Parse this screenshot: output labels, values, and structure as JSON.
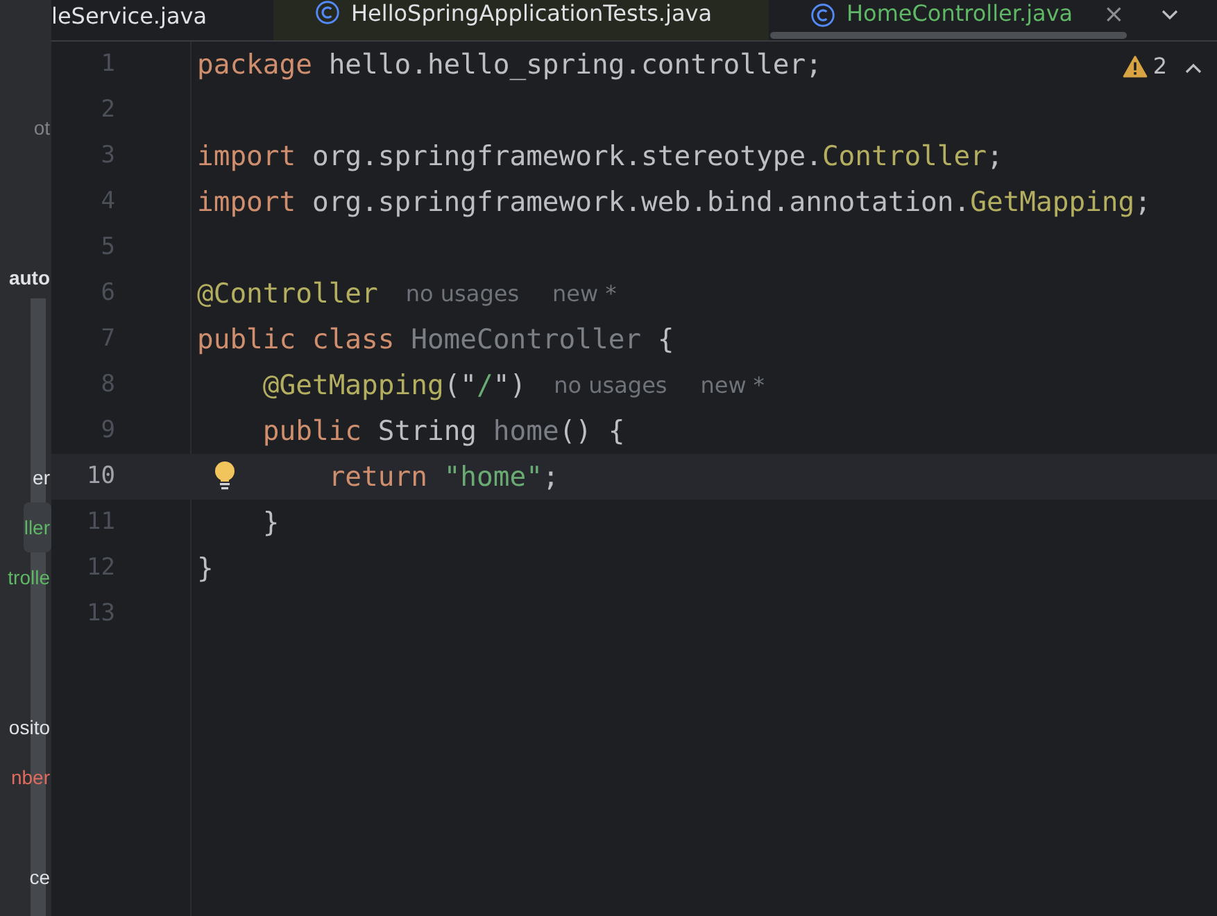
{
  "sidebar": {
    "items": [
      {
        "label": "ot",
        "kind": "file",
        "color": "#7e8187",
        "selected": false
      },
      {
        "label": "auto",
        "kind": "module",
        "color": "#dfe1e5",
        "selected": false
      },
      {
        "label": "er",
        "kind": "file",
        "color": "#dfe1e5",
        "selected": false
      },
      {
        "label": "ller",
        "kind": "file",
        "color": "#5fb865",
        "selected": true
      },
      {
        "label": "trolle",
        "kind": "file",
        "color": "#5fb865",
        "selected": false
      },
      {
        "label": "osito",
        "kind": "file",
        "color": "#dfe1e5",
        "selected": false
      },
      {
        "label": "nber",
        "kind": "file",
        "color": "#e06c5f",
        "selected": false
      },
      {
        "label": "ce",
        "kind": "file",
        "color": "#dfe1e5",
        "selected": false
      }
    ]
  },
  "tabs": [
    {
      "label": "leService.java",
      "icon": false,
      "color": "#dfe1e5",
      "selected": false,
      "closable": false
    },
    {
      "label": "HelloSpringApplicationTests.java",
      "icon": true,
      "color": "#dfe1e5",
      "selected": false,
      "closable": false
    },
    {
      "label": "HomeController.java",
      "icon": true,
      "color": "#5fb865",
      "selected": true,
      "closable": true
    }
  ],
  "tab_close": "×",
  "inspections": {
    "warnings": "2"
  },
  "lines": [
    {
      "number": "1",
      "current": false,
      "bulb": false,
      "tokens": [
        {
          "kind": "keyword",
          "text": "package "
        },
        {
          "kind": "plain",
          "text": "hello.hello_spring.controller;"
        }
      ]
    },
    {
      "number": "2",
      "current": false,
      "bulb": false
    },
    {
      "number": "3",
      "current": false,
      "bulb": false,
      "tokens": [
        {
          "kind": "keyword",
          "text": "import "
        },
        {
          "kind": "plain",
          "text": "org.springframework.stereotype."
        },
        {
          "kind": "annotation",
          "text": "Controller"
        },
        {
          "kind": "plain",
          "text": ";"
        }
      ]
    },
    {
      "number": "4",
      "current": false,
      "bulb": false,
      "tokens": [
        {
          "kind": "keyword",
          "text": "import "
        },
        {
          "kind": "plain",
          "text": "org.springframework.web.bind.annotation."
        },
        {
          "kind": "annotation",
          "text": "GetMapping"
        },
        {
          "kind": "plain",
          "text": ";"
        }
      ]
    },
    {
      "number": "5",
      "current": false,
      "bulb": false
    },
    {
      "number": "6",
      "current": false,
      "bulb": false,
      "tokens": [
        {
          "kind": "annotation",
          "text": "@Controller"
        }
      ],
      "hints": [
        "no usages",
        "new *"
      ]
    },
    {
      "number": "7",
      "current": false,
      "bulb": false,
      "tokens": [
        {
          "kind": "keyword",
          "text": "public class "
        },
        {
          "kind": "unused",
          "text": "HomeController"
        },
        {
          "kind": "plain",
          "text": " {"
        }
      ]
    },
    {
      "number": "8",
      "current": false,
      "bulb": false,
      "tokens": [
        {
          "kind": "annotation",
          "text": "    @GetMapping"
        },
        {
          "kind": "plain",
          "text": "(\""
        },
        {
          "kind": "string",
          "text": "/"
        },
        {
          "kind": "plain",
          "text": "\")"
        }
      ],
      "hints": [
        "no usages",
        "new *"
      ]
    },
    {
      "number": "9",
      "current": false,
      "bulb": false,
      "tokens": [
        {
          "kind": "keyword",
          "text": "    public "
        },
        {
          "kind": "plain",
          "text": "String "
        },
        {
          "kind": "unused",
          "text": "home"
        },
        {
          "kind": "plain",
          "text": "() {"
        }
      ]
    },
    {
      "number": "10",
      "current": true,
      "bulb": true,
      "tokens": [
        {
          "kind": "keyword",
          "text": "        return "
        },
        {
          "kind": "string",
          "text": "\"home\""
        },
        {
          "kind": "plain",
          "text": ";"
        }
      ]
    },
    {
      "number": "11",
      "current": false,
      "bulb": false,
      "tokens": [
        {
          "kind": "plain",
          "text": "    }"
        }
      ]
    },
    {
      "number": "12",
      "current": false,
      "bulb": false,
      "tokens": [
        {
          "kind": "plain",
          "text": "}"
        }
      ]
    },
    {
      "number": "13",
      "current": false,
      "bulb": false
    }
  ]
}
